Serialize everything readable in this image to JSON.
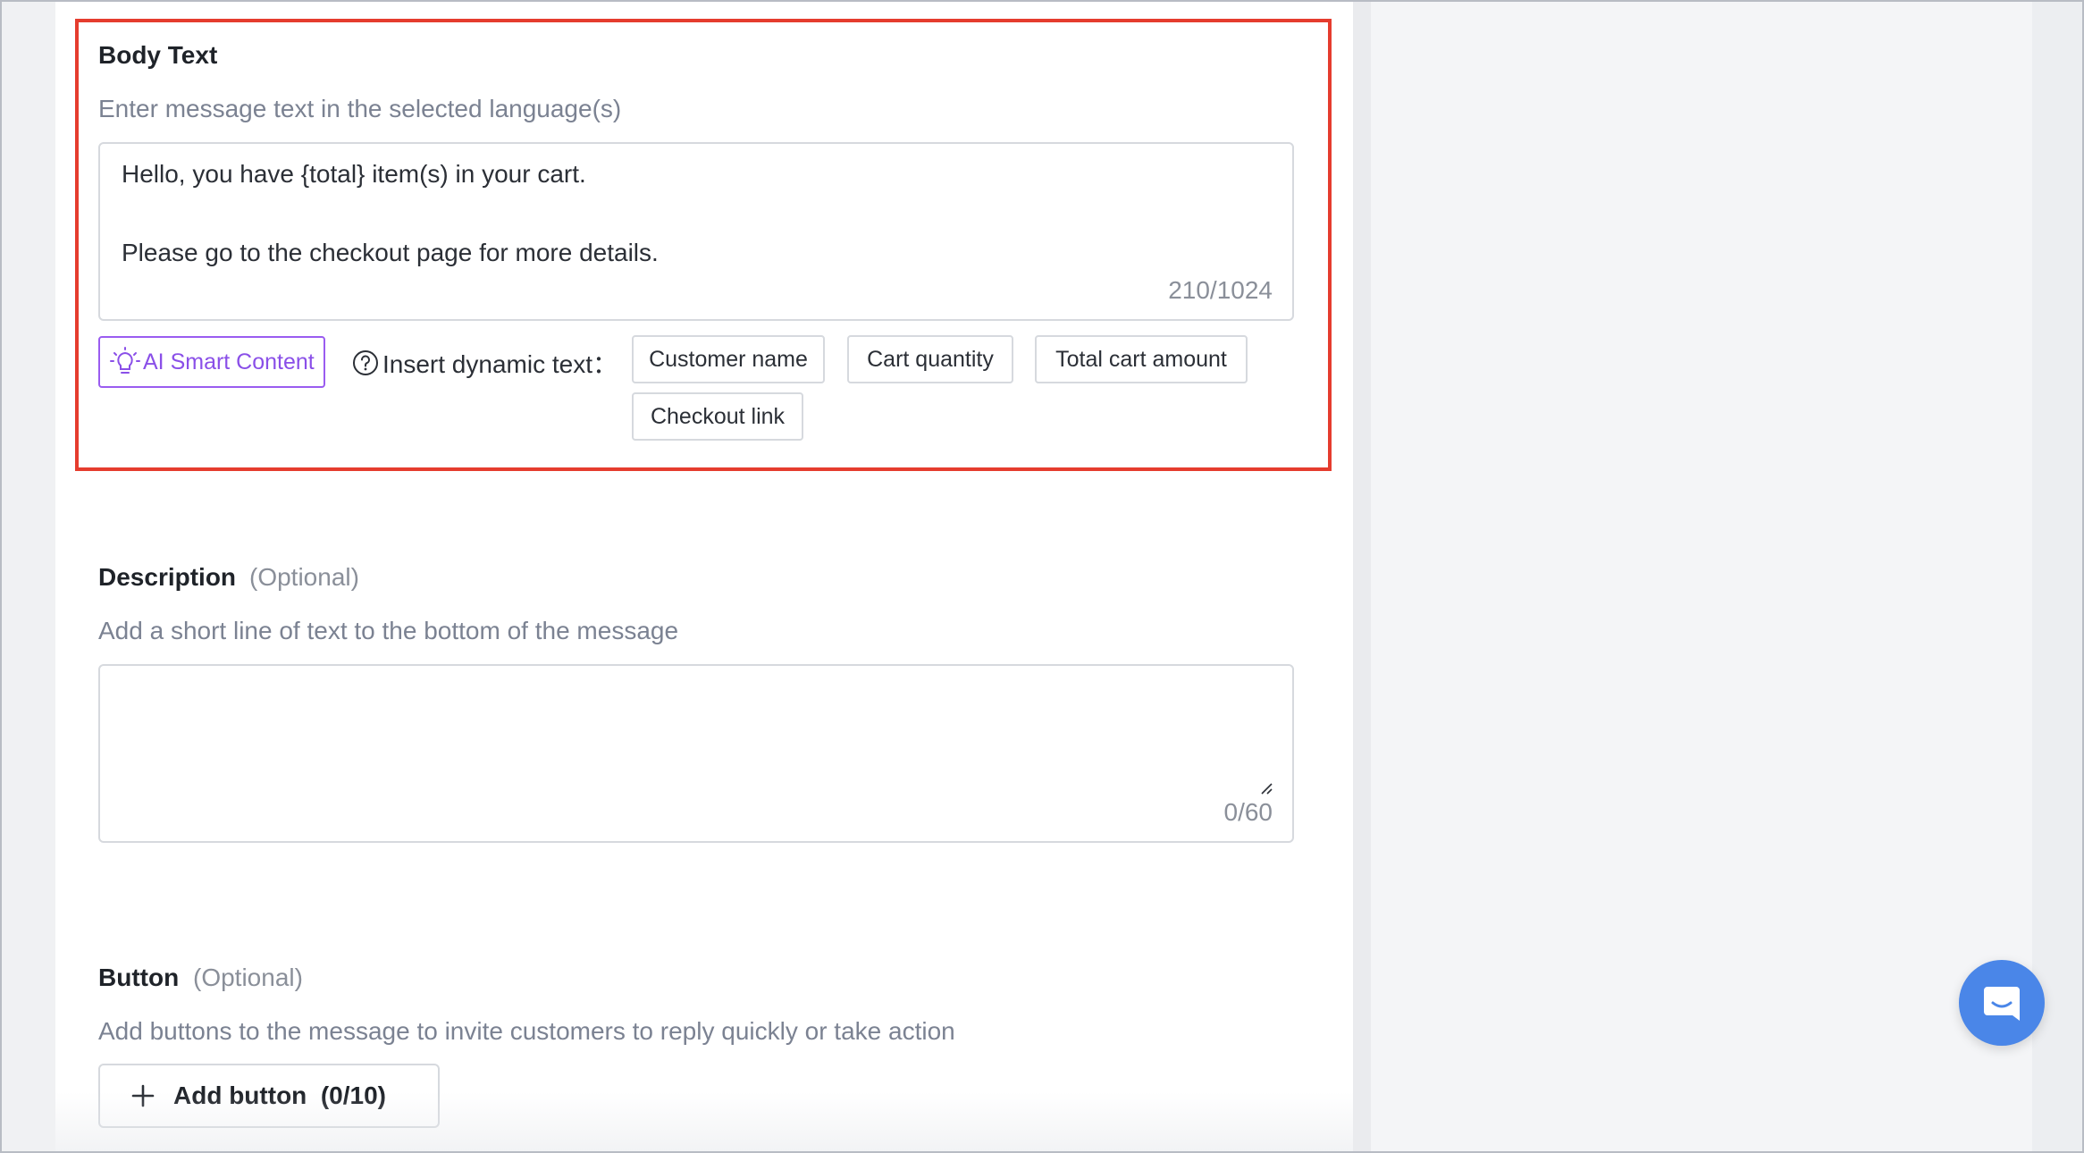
{
  "body_text": {
    "title": "Body Text",
    "hint": "Enter message text in the selected language(s)",
    "lines": [
      "Hello, you have {total} item(s) in your cart.",
      "Please go to the checkout page for more details."
    ],
    "counter": "210/1024",
    "ai_button_label": "AI Smart Content",
    "insert_label": "Insert dynamic text：",
    "chips": [
      "Customer name",
      "Cart quantity",
      "Total cart amount",
      "Checkout link"
    ]
  },
  "description": {
    "title": "Description",
    "optional": "(Optional)",
    "hint": "Add a short line of text to the bottom of the message",
    "value": "",
    "counter": "0/60"
  },
  "button_section": {
    "title": "Button",
    "optional": "(Optional)",
    "hint": "Add buttons to the message to invite customers to reply quickly or take action",
    "add_label": "Add button  (0/10)"
  },
  "icons": {
    "ai": "lightbulb-icon",
    "help": "question-circle-icon",
    "add": "plus-icon",
    "chat": "chat-bubble-icon"
  },
  "colors": {
    "highlight": "#e53c2e",
    "ai_accent": "#9a5cf0",
    "chat_launcher": "#4a86e8"
  }
}
